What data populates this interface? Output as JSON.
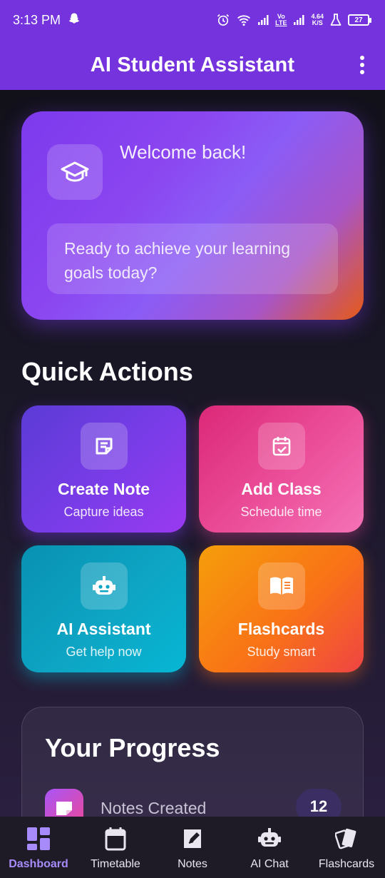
{
  "status_bar": {
    "time": "3:13 PM",
    "network_speed": "4.64",
    "network_speed_unit": "K/S",
    "volte_label": "Vo",
    "lte_label": "LTE",
    "battery": "27"
  },
  "app_bar": {
    "title": "AI Student Assistant"
  },
  "welcome": {
    "title": "Welcome back!",
    "message": "Ready to achieve your learning goals today?"
  },
  "quick_actions": {
    "title": "Quick Actions",
    "items": [
      {
        "title": "Create Note",
        "subtitle": "Capture ideas"
      },
      {
        "title": "Add Class",
        "subtitle": "Schedule time"
      },
      {
        "title": "AI Assistant",
        "subtitle": "Get help now"
      },
      {
        "title": "Flashcards",
        "subtitle": "Study smart"
      }
    ]
  },
  "progress": {
    "title": "Your Progress",
    "rows": [
      {
        "label": "Notes Created",
        "count": "12"
      }
    ]
  },
  "bottom_nav": {
    "items": [
      {
        "label": "Dashboard",
        "icon": "dashboard-icon",
        "active": true
      },
      {
        "label": "Timetable",
        "icon": "calendar-icon"
      },
      {
        "label": "Notes",
        "icon": "note-edit-icon"
      },
      {
        "label": "AI Chat",
        "icon": "robot-icon"
      },
      {
        "label": "Flashcards",
        "icon": "cards-icon"
      }
    ]
  },
  "colors": {
    "primary": "#7433dc",
    "active_nav": "#a78bfa"
  }
}
